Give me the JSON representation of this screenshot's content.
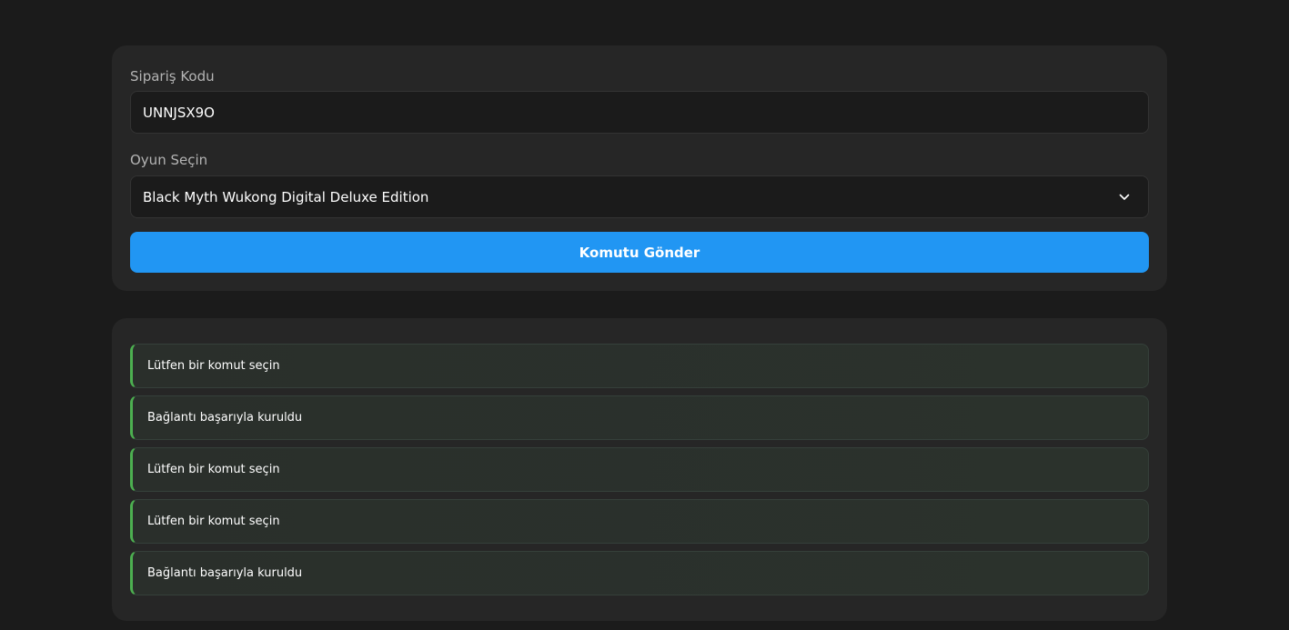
{
  "form": {
    "order_code_label": "Sipariş Kodu",
    "order_code_value": "UNNJSX9O",
    "game_label": "Oyun Seçin",
    "game_selected": "Black Myth Wukong Digital Deluxe Edition",
    "submit_label": "Komutu Gönder"
  },
  "log": {
    "items": [
      "Lütfen bir komut seçin",
      "Bağlantı başarıyla kuruldu",
      "Lütfen bir komut seçin",
      "Lütfen bir komut seçin",
      "Bağlantı başarıyla kuruldu"
    ]
  },
  "colors": {
    "background": "#1b1b1b",
    "card": "#262626",
    "accent": "#2196f3",
    "success": "#4caf50"
  },
  "icons": {
    "select_chevron": "chevron-down-icon"
  }
}
